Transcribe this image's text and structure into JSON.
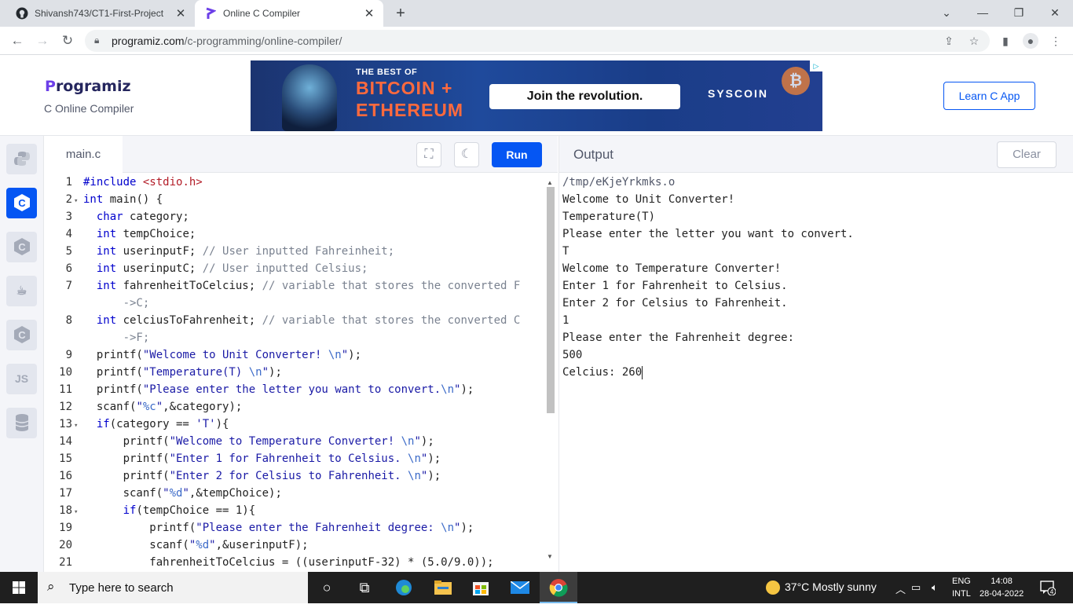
{
  "browser": {
    "tabs": [
      {
        "title": "Shivansh743/CT1-First-Project",
        "icon": "github-icon"
      },
      {
        "title": "Online C Compiler",
        "icon": "programiz-icon"
      }
    ],
    "url_domain": "programiz.com",
    "url_path": "/c-programming/online-compiler/"
  },
  "header": {
    "logo_p": "P",
    "logo_rest": "rogramiz",
    "subtitle": "C Online Compiler",
    "learn_button": "Learn C App",
    "ad": {
      "best_of": "THE BEST OF",
      "line1": "BITCOIN +",
      "line2": "ETHEREUM",
      "cta": "Join the revolution.",
      "brand": "SYSCOIN"
    }
  },
  "sidebar": {
    "languages": [
      {
        "name": "python",
        "glyph": "py"
      },
      {
        "name": "c",
        "glyph": "C"
      },
      {
        "name": "cpp",
        "glyph": "C"
      },
      {
        "name": "java",
        "glyph": "☕"
      },
      {
        "name": "csharp",
        "glyph": "C"
      },
      {
        "name": "javascript",
        "glyph": "JS"
      },
      {
        "name": "sql",
        "glyph": "≡"
      }
    ]
  },
  "editor": {
    "filename": "main.c",
    "run_label": "Run",
    "line_numbers": [
      "1",
      "2",
      "3",
      "4",
      "5",
      "6",
      "7",
      "",
      "8",
      "",
      "9",
      "10",
      "11",
      "12",
      "13",
      "14",
      "15",
      "16",
      "17",
      "18",
      "19",
      "20",
      "21"
    ]
  },
  "output": {
    "title": "Output",
    "clear_label": "Clear",
    "lines": [
      "/tmp/eKjeYrkmks.o",
      "Welcome to Unit Converter!",
      "Temperature(T)",
      "Please enter the letter you want to convert.",
      "T",
      "Welcome to Temperature Converter!",
      "Enter 1 for Fahrenheit to Celsius.",
      "Enter 2 for Celsius to Fahrenheit.",
      "1",
      "Please enter the Fahrenheit degree:",
      "500",
      "Celcius: 260"
    ]
  },
  "taskbar": {
    "search_placeholder": "Type here to search",
    "weather": "37°C  Mostly sunny",
    "lang_top": "ENG",
    "lang_bottom": "INTL",
    "time": "14:08",
    "date": "28-04-2022",
    "notifications": "4"
  }
}
